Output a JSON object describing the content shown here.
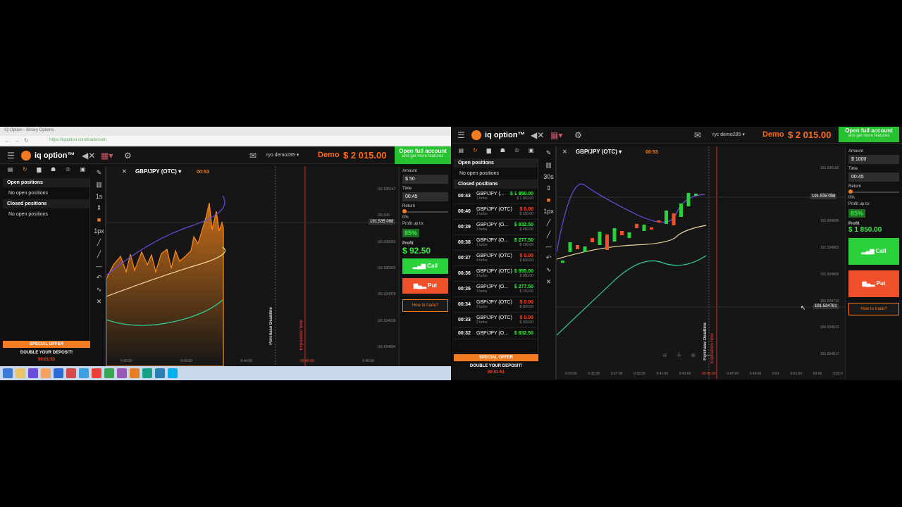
{
  "left": {
    "browser_tab": "IQ Option - Binary Options",
    "url": "https://iqoption.com/traderoom",
    "logo": "iq option™",
    "user": "ryo demo285 ▾",
    "demo_label": "Demo",
    "balance": "$ 2 015.00",
    "open_account": "Open full account",
    "open_account_sub": "and get more features",
    "asset": "GBP/JPY (OTC)",
    "timer": "00:53",
    "open_positions_label": "Open positions",
    "open_positions_empty": "No open positions",
    "closed_positions_label": "Closed positions",
    "closed_positions_empty": "No open positions",
    "special_offer": "SPECIAL OFFER",
    "double_deposit": "DOUBLE YOUR DEPOSIT!",
    "offer_timer": "00:01:53",
    "amount_label": "Amount",
    "amount_value": "$ 50",
    "time_label": "Time",
    "time_value": "00:45",
    "return_label": "Return",
    "return_pct": "0%",
    "profit_up_label": "Profit up to:",
    "profit_pct": "85%",
    "profit_label": "Profit",
    "profit_value": "$ 92.50",
    "call": "Call",
    "put": "Put",
    "how_to_trade": "How to trade?",
    "price_tag": "191.535 098",
    "y_ticks": [
      "191.535147",
      "191.535",
      "191.535063",
      "191.535020",
      "191.534978",
      "191.534936",
      "191.534894"
    ],
    "x_ticks": [
      "0:42:00",
      "0:43:00",
      "0:44:00",
      "00:45:00",
      "0:46:00"
    ],
    "purchase_deadline": "Purchase Deadline",
    "expiration_time": "Expiration time",
    "tools": [
      "✎",
      "▥",
      "1s",
      "⇕",
      "■",
      "1px",
      "╱",
      "╱",
      "—",
      "↶",
      "∿",
      "✕"
    ]
  },
  "right": {
    "logo": "iq option™",
    "user": "ryc demo285 ▾",
    "demo_label": "Demo",
    "balance": "$ 2 015.00",
    "open_account": "Open full account",
    "open_account_sub": "and get more features",
    "asset": "GBP/JPY (OTC)",
    "timer": "00:53",
    "open_positions_label": "Open positions",
    "open_positions_empty": "No open positions",
    "closed_positions_label": "Closed positions",
    "trades": [
      {
        "time": "00:43",
        "asset": "GBP/JPY (...",
        "profit": "$ 1 850.00",
        "sub": "1 turbo",
        "sub2": "$ 1 000.00",
        "color": "#3eea49"
      },
      {
        "time": "00:40",
        "asset": "GBP/JPY (OTC)",
        "profit": "$ 0.00",
        "sub": "1 turbo",
        "sub2": "$ 150.00",
        "color": "#ff4a2a"
      },
      {
        "time": "00:39",
        "asset": "GBP/JPY (O...",
        "profit": "$ 832.50",
        "sub": "3 turbo",
        "sub2": "$ 450.00",
        "color": "#3eea49"
      },
      {
        "time": "00:38",
        "asset": "GBP/JPY (O...",
        "profit": "$ 277.50",
        "sub": "1 turbo",
        "sub2": "$ 150.00",
        "color": "#3eea49"
      },
      {
        "time": "00:37",
        "asset": "GBP/JPY (OTC)",
        "profit": "$ 0.00",
        "sub": "4 turbo",
        "sub2": "$ 600.00",
        "color": "#ff4a2a"
      },
      {
        "time": "00:36",
        "asset": "GBP/JPY (OTC)",
        "profit": "$ 555.00",
        "sub": "2 turbo",
        "sub2": "$ 300.00",
        "color": "#3eea49"
      },
      {
        "time": "00:35",
        "asset": "GBP/JPY (O...",
        "profit": "$ 277.50",
        "sub": "3 turbo",
        "sub2": "$ 150.00",
        "color": "#3eea49"
      },
      {
        "time": "00:34",
        "asset": "GBP/JPY (OTC)",
        "profit": "$ 0.00",
        "sub": "2 turbo",
        "sub2": "$ 300.00",
        "color": "#ff4a2a"
      },
      {
        "time": "00:33",
        "asset": "GBP/JPY (OTC)",
        "profit": "$ 0.00",
        "sub": "2 turbo",
        "sub2": "$ 300.00",
        "color": "#ff4a2a"
      },
      {
        "time": "00:32",
        "asset": "GBP/JPY (O...",
        "profit": "$ 832.50",
        "sub": "",
        "sub2": "",
        "color": "#3eea49"
      }
    ],
    "special_offer": "SPECIAL OFFER",
    "double_deposit": "DOUBLE YOUR DEPOSIT!",
    "offer_timer": "00:01:51",
    "amount_label": "Amount",
    "amount_value": "$ 1000",
    "time_label": "Time",
    "time_value": "00:45",
    "return_label": "Return",
    "return_pct": "0%",
    "profit_up_label": "Profit up to:",
    "profit_pct": "85%",
    "profit_label": "Profit",
    "profit_value": "$ 1 850.00",
    "call": "Call",
    "put": "Put",
    "how_to_trade": "How to trade?",
    "price_tag": "191.535 098",
    "price_tag2": "191.534781",
    "y_ticks": [
      "191.535192",
      "191.535",
      "191.534995",
      "191.534903",
      "191.534809",
      "191.534710",
      "191.534613",
      "191.534517"
    ],
    "x_ticks": [
      "0:33:00",
      "0:35:00",
      "0:37:00",
      "0:39:00",
      "0:41:00",
      "0:43:00",
      "00:45:30",
      "0:47:00",
      "0:49:00",
      "0:51",
      "0:51:54",
      "53:00",
      "0:55:0"
    ],
    "purchase_deadline": "Purchase Deadline",
    "expiration_time": "Expiration time",
    "tools": [
      "✎",
      "▥",
      "30s",
      "⇕",
      "■",
      "1px",
      "╱",
      "╱",
      "—",
      "↶",
      "∿",
      "✕"
    ]
  },
  "colors": {
    "accent": "#f47c20",
    "green": "#2bd13a",
    "red": "#f0512b"
  }
}
